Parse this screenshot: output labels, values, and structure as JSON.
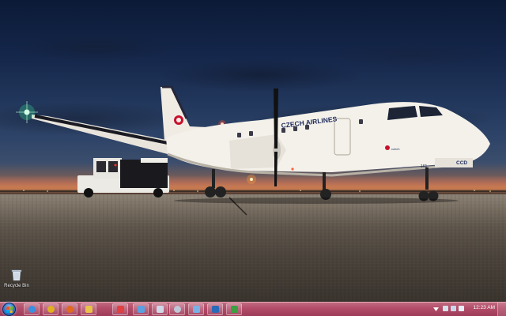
{
  "wallpaper": {
    "livery_text": "CZECH AIRLINES",
    "registration": "CCD",
    "fin_number": "161"
  },
  "desktop": {
    "icons": [
      {
        "label": "Recycle Bin",
        "icon": "recycle-bin-icon"
      }
    ]
  },
  "taskbar": {
    "colors": {
      "base": "#b34e6a",
      "highlight": "#e6a4b4"
    },
    "start": {
      "icon": "windows-start-orb-icon"
    },
    "pinned": [
      {
        "icon": "internet-explorer-icon",
        "color": "#3a8fe0"
      },
      {
        "icon": "chrome-icon",
        "color": "#e0b020"
      },
      {
        "icon": "firefox-icon",
        "color": "#e06a20"
      },
      {
        "icon": "windows-explorer-icon",
        "color": "#e8c24a"
      },
      {
        "icon": "media-player-icon",
        "color": "#e04040"
      },
      {
        "icon": "application-icon",
        "color": "#5aa0e0"
      },
      {
        "icon": "document-icon",
        "color": "#d0d8e8"
      },
      {
        "icon": "settings-icon",
        "color": "#c0c8d8"
      },
      {
        "icon": "network-icon",
        "color": "#7ab0e8"
      },
      {
        "icon": "security-icon",
        "color": "#2a6ab8"
      },
      {
        "icon": "project-icon",
        "color": "#3aa040"
      }
    ],
    "tray": {
      "time": "12:23 AM"
    }
  }
}
